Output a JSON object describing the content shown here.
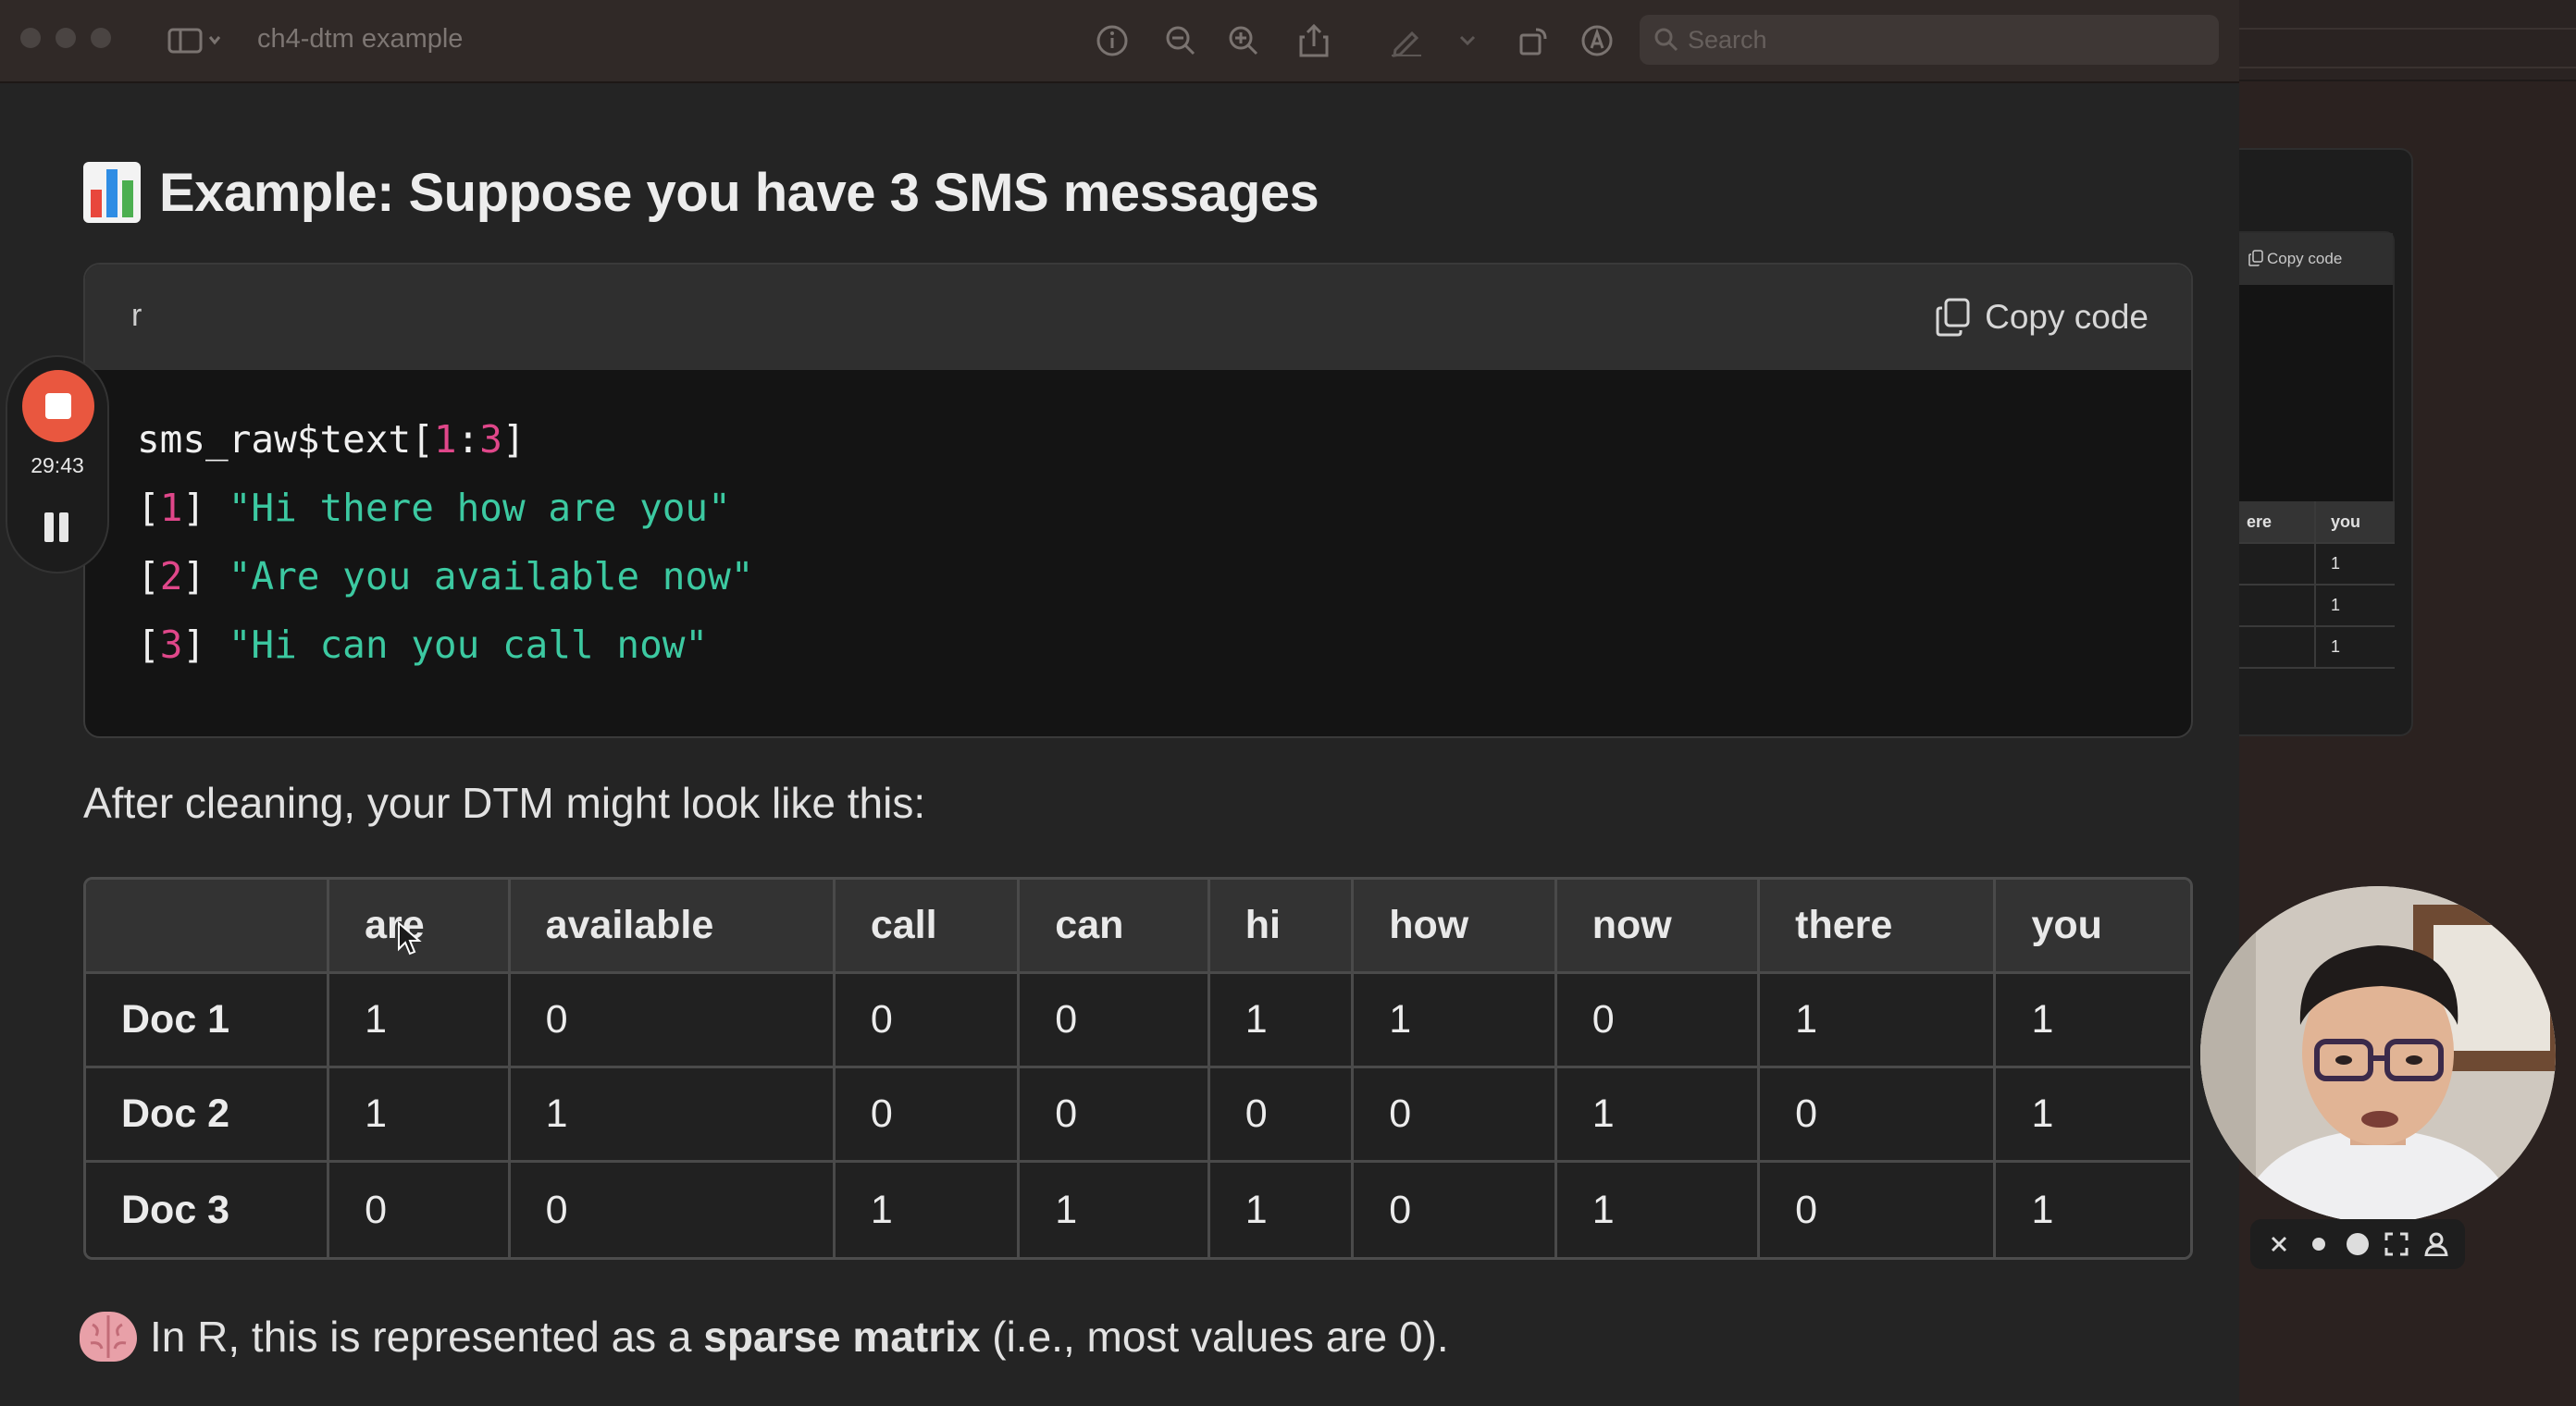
{
  "window": {
    "title": "ch4-dtm example",
    "search_placeholder": "Search"
  },
  "content": {
    "heading": "Example: Suppose you have 3 SMS messages",
    "code": {
      "language": "r",
      "copy_label": "Copy code",
      "line1": {
        "prefix": "sms_raw$text[",
        "a": "1",
        "sep": ":",
        "b": "3",
        "suffix": "]"
      },
      "outputs": [
        {
          "open": "[",
          "index": "1",
          "close": "]",
          "text": "\"Hi there how are you\""
        },
        {
          "open": "[",
          "index": "2",
          "close": "]",
          "text": "\"Are you available now\""
        },
        {
          "open": "[",
          "index": "3",
          "close": "]",
          "text": "\"Hi can you call now\""
        }
      ]
    },
    "paragraph": "After cleaning, your DTM might look like this:",
    "table": {
      "columns": [
        "",
        "are",
        "available",
        "call",
        "can",
        "hi",
        "how",
        "now",
        "there",
        "you"
      ],
      "rows": [
        [
          "Doc 1",
          "1",
          "0",
          "0",
          "0",
          "1",
          "1",
          "0",
          "1",
          "1"
        ],
        [
          "Doc 2",
          "1",
          "1",
          "0",
          "0",
          "0",
          "0",
          "1",
          "0",
          "1"
        ],
        [
          "Doc 3",
          "0",
          "0",
          "1",
          "1",
          "1",
          "0",
          "1",
          "0",
          "1"
        ]
      ]
    },
    "note": {
      "before": "In R, this is represented as a ",
      "bold": "sparse matrix",
      "after": " (i.e., most values are 0)."
    }
  },
  "recorder": {
    "time": "29:43"
  },
  "background_window": {
    "copy_label": "Copy code",
    "table": {
      "columns": [
        "ere",
        "you"
      ],
      "rows": [
        [
          "",
          "1"
        ],
        [
          "",
          "1"
        ],
        [
          "",
          "1"
        ]
      ]
    }
  },
  "icons": {
    "sidebar": "sidebar-icon",
    "info": "info-icon",
    "zoom_out": "zoom-out-icon",
    "zoom_in": "zoom-in-icon",
    "share": "share-icon",
    "markup": "pen-icon",
    "rotate": "rotate-icon",
    "annotate": "annotate-icon",
    "search": "search-icon",
    "copy": "copy-icon"
  },
  "colors": {
    "code_number": "#e0478a",
    "code_string": "#3cc9a1",
    "record_button": "#e9573f"
  }
}
